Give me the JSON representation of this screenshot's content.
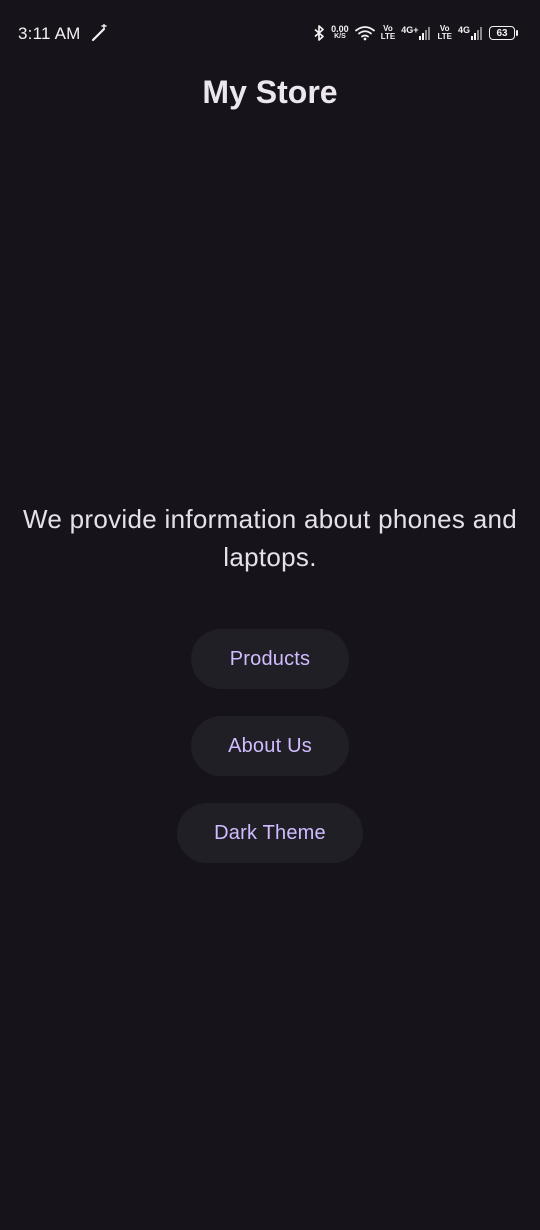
{
  "status_bar": {
    "time": "3:11 AM",
    "net_speed_value": "0.00",
    "net_speed_unit": "K/S",
    "sim1_top": "Vo",
    "sim1_bottom": "LTE",
    "sim1_network": "4G+",
    "sim2_top": "Vo",
    "sim2_bottom": "LTE",
    "sim2_network": "4G",
    "battery_level": "63",
    "icons": [
      "wand-icon",
      "bluetooth-icon",
      "wifi-icon",
      "signal-icon",
      "battery-icon"
    ]
  },
  "app": {
    "title": "My Store",
    "tagline": "We provide information about phones and laptops."
  },
  "buttons": {
    "products": "Products",
    "about": "About Us",
    "dark_theme": "Dark Theme"
  },
  "colors": {
    "background": "#16131a",
    "button_background": "#211f26",
    "button_text": "#d0bcff",
    "text": "#e6e1e9"
  }
}
